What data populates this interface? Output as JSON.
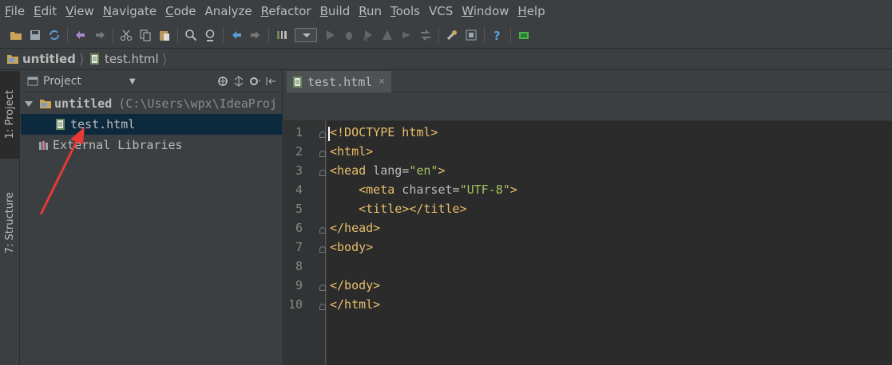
{
  "menu": [
    {
      "mnemonic": "F",
      "rest": "ile"
    },
    {
      "mnemonic": "E",
      "rest": "dit"
    },
    {
      "mnemonic": "V",
      "rest": "iew"
    },
    {
      "mnemonic": "N",
      "rest": "avigate"
    },
    {
      "mnemonic": "C",
      "rest": "ode"
    },
    {
      "mnemonic": "",
      "rest": "Analyze"
    },
    {
      "mnemonic": "R",
      "rest": "efactor"
    },
    {
      "mnemonic": "B",
      "rest": "uild"
    },
    {
      "mnemonic": "R",
      "rest": "un"
    },
    {
      "mnemonic": "T",
      "rest": "ools"
    },
    {
      "mnemonic": "",
      "rest": "VCS"
    },
    {
      "mnemonic": "W",
      "rest": "indow"
    },
    {
      "mnemonic": "H",
      "rest": "elp"
    }
  ],
  "toolbar_icons": [
    "open-folder-icon",
    "save-all-icon",
    "sync-icon",
    "undo-icon",
    "redo-icon",
    "cut-icon",
    "copy-icon",
    "paste-icon",
    "find-icon",
    "replace-icon",
    "back-icon",
    "forward-icon",
    "make-project-icon",
    "run-config-dropdown",
    "run-icon",
    "debug-icon",
    "coverage-icon",
    "profile-icon",
    "stop-icon",
    "build-artifacts-icon",
    "settings-icon",
    "project-structure-icon",
    "help-icon",
    "sdk-icon"
  ],
  "breadcrumb": {
    "project": "untitled",
    "file": "test.html"
  },
  "sidebar": {
    "project_tab": "1: Project",
    "structure_tab": "7: Structure"
  },
  "project_panel": {
    "view_selector": "Project",
    "root_name": "untitled",
    "root_path": "(C:\\Users\\wpx\\IdeaProj",
    "file_name": "test.html",
    "external_libraries": "External Libraries"
  },
  "editor": {
    "tab_title": "test.html",
    "tab_close": "×",
    "line_numbers": [
      "1",
      "2",
      "3",
      "4",
      "5",
      "6",
      "7",
      "8",
      "9",
      "10"
    ],
    "lines": {
      "l1_a": "<!DOCTYPE",
      "l1_b": " html>",
      "l2": "<html>",
      "l3_a": "<head",
      "l3_b": " lang=",
      "l3_c": "\"en\"",
      "l3_d": ">",
      "l4_a": "    <meta",
      "l4_b": " charset=",
      "l4_c": "\"UTF-8\"",
      "l4_d": ">",
      "l5": "    <title></title>",
      "l6": "</head>",
      "l7": "<body>",
      "l8": "",
      "l9": "</body>",
      "l10": "</html>"
    }
  },
  "colors": {
    "background": "#3c3f41",
    "editor_bg": "#2b2b2b",
    "tag": "#e8bf6a",
    "string": "#a5c25c",
    "selection": "#0d293e",
    "annotation_arrow": "#e53935"
  }
}
